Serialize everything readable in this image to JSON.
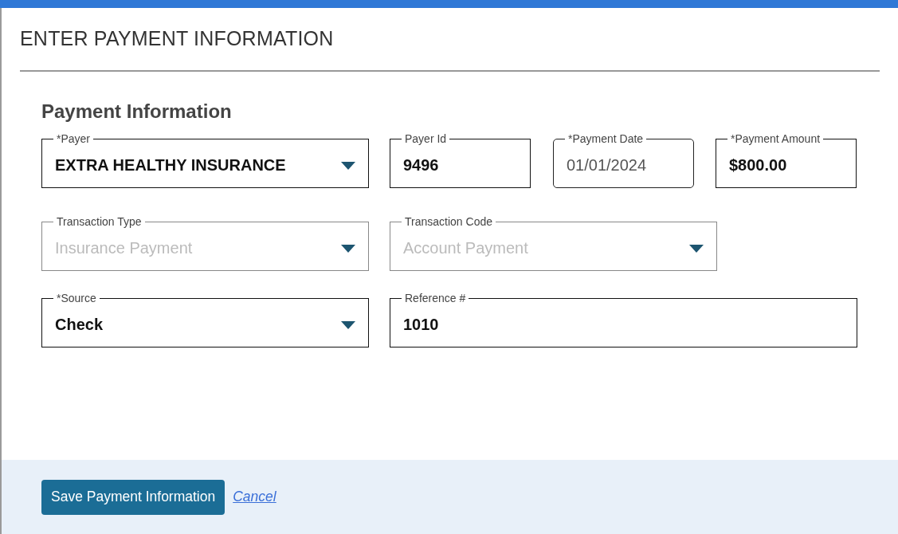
{
  "dialog": {
    "title": "ENTER PAYMENT INFORMATION"
  },
  "section": {
    "heading": "Payment Information"
  },
  "rows": [
    [
      {
        "kind": "select",
        "label": "*Payer",
        "value": "EXTRA HEALTHY INSURANCE",
        "disabled": false
      },
      {
        "kind": "text",
        "label": "Payer Id",
        "value": "9496",
        "disabled": false
      },
      {
        "kind": "date",
        "label": "*Payment Date",
        "value": "01/01/2024",
        "disabled": false
      },
      {
        "kind": "text",
        "label": "*Payment Amount",
        "value": "$800.00",
        "disabled": false
      }
    ],
    [
      {
        "kind": "select",
        "label": "Transaction Type",
        "value": "Insurance Payment",
        "disabled": true
      },
      {
        "kind": "select",
        "label": "Transaction Code",
        "value": "Account Payment",
        "disabled": true
      }
    ],
    [
      {
        "kind": "select",
        "label": "*Source",
        "value": "Check",
        "disabled": false
      },
      {
        "kind": "text",
        "label": "Reference #",
        "value": "1010",
        "disabled": false
      }
    ]
  ],
  "footer": {
    "save_button": "Save Payment Information",
    "cancel_link": "Cancel"
  }
}
